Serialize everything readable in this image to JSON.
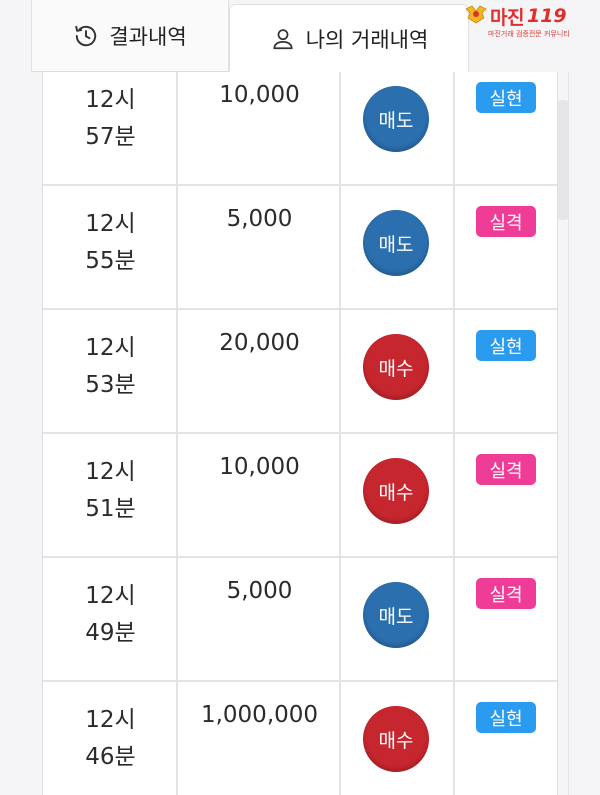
{
  "tabs": {
    "results": {
      "label": "결과내역",
      "icon": "history-icon"
    },
    "my_trades": {
      "label": "나의 거래내역",
      "icon": "user-icon",
      "active": true
    }
  },
  "logo": {
    "text": "마진",
    "suffix": "119",
    "subtitle": "마진거래 검증전문 커뮤니티"
  },
  "colors": {
    "sell": "#2b6fae",
    "buy": "#c6262e",
    "hit": "#2a9bee",
    "miss": "#ef3d97"
  },
  "trades": [
    {
      "hour": "12시",
      "minute": "57분",
      "amount": "10,000",
      "type": "매도",
      "kind": "sell",
      "result": "실현",
      "result_kind": "hit"
    },
    {
      "hour": "12시",
      "minute": "55분",
      "amount": "5,000",
      "type": "매도",
      "kind": "sell",
      "result": "실격",
      "result_kind": "miss"
    },
    {
      "hour": "12시",
      "minute": "53분",
      "amount": "20,000",
      "type": "매수",
      "kind": "buy",
      "result": "실현",
      "result_kind": "hit"
    },
    {
      "hour": "12시",
      "minute": "51분",
      "amount": "10,000",
      "type": "매수",
      "kind": "buy",
      "result": "실격",
      "result_kind": "miss"
    },
    {
      "hour": "12시",
      "minute": "49분",
      "amount": "5,000",
      "type": "매도",
      "kind": "sell",
      "result": "실격",
      "result_kind": "miss"
    },
    {
      "hour": "12시",
      "minute": "46분",
      "amount": "1,000,000",
      "type": "매수",
      "kind": "buy",
      "result": "실현",
      "result_kind": "hit"
    }
  ]
}
